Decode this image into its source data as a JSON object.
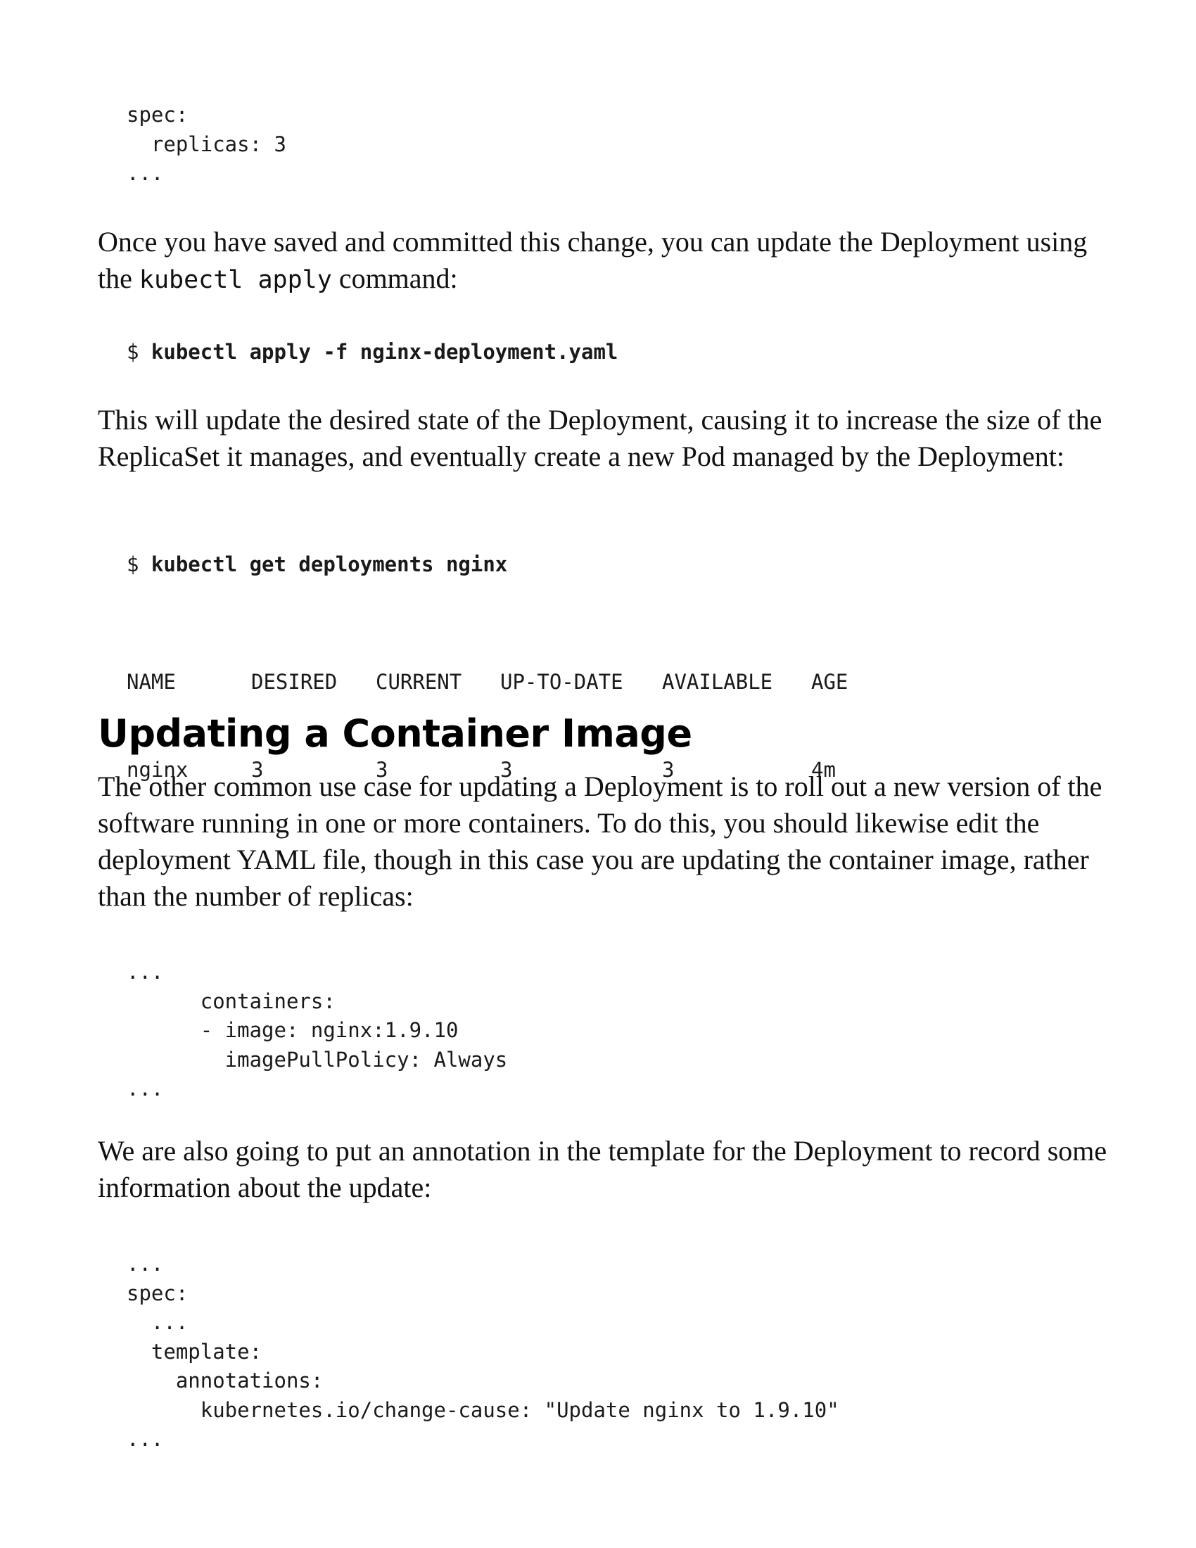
{
  "code_block_1": {
    "lines": [
      "spec:",
      "  replicas: 3",
      "..."
    ]
  },
  "para_1": {
    "before": "Once you have saved and committed this change, you can update the Deployment using the ",
    "code": "kubectl apply",
    "after": " command:"
  },
  "command_1": {
    "prompt": "$ ",
    "command": "kubectl apply -f nginx-deployment.yaml"
  },
  "para_2": {
    "text": "This will update the desired state of the Deployment, causing it to increase the size of the ReplicaSet it manages, and eventually create a new Pod managed by the Deployment:"
  },
  "command_2": {
    "prompt": "$ ",
    "command": "kubectl get deployments nginx"
  },
  "deployments_table": {
    "headers": [
      "NAME",
      "DESIRED",
      "CURRENT",
      "UP-TO-DATE",
      "AVAILABLE",
      "AGE"
    ],
    "rows": [
      [
        "nginx",
        "3",
        "3",
        "3",
        "3",
        "4m"
      ]
    ]
  },
  "section_heading": "Updating a Container Image",
  "para_3": {
    "text": "The other common use case for updating a Deployment is to roll out a new version of the software running in one or more containers. To do this, you should likewise edit the deployment YAML file, though in this case you are updating the container image, rather than the number of replicas:"
  },
  "code_block_2": {
    "lines": [
      "...",
      "      containers:",
      "      - image: nginx:1.9.10",
      "        imagePullPolicy: Always",
      "..."
    ]
  },
  "para_4": {
    "text": "We are also going to put an annotation in the template for the Deployment to record some information about the update:"
  },
  "code_block_3": {
    "lines": [
      "...",
      "spec:",
      "  ...",
      "  template:",
      "    annotations:",
      "      kubernetes.io/change-cause: \"Update nginx to 1.9.10\"",
      "..."
    ]
  }
}
